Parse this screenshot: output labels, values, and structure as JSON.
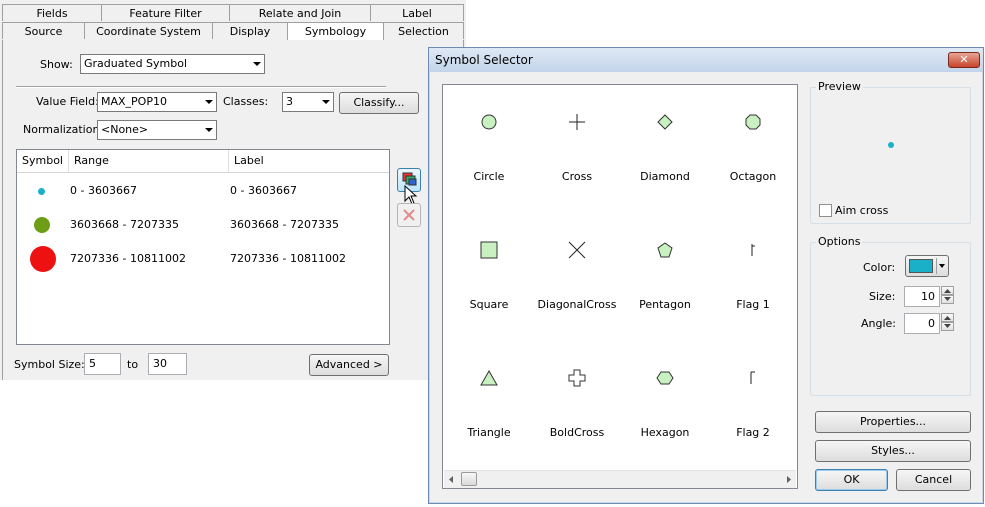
{
  "props": {
    "tabs_row1": [
      "Fields",
      "Feature Filter",
      "Relate and Join",
      "Label"
    ],
    "tabs_row2": [
      "Source",
      "Coordinate System",
      "Display",
      "Symbology",
      "Selection"
    ],
    "active_tab": "Symbology",
    "show_label": "Show:",
    "show_value": "Graduated Symbol",
    "value_field_label": "Value Field:",
    "value_field_value": "MAX_POP10",
    "classes_label": "Classes:",
    "classes_value": "3",
    "classify_button": "Classify...",
    "normalization_label": "Normalization:",
    "normalization_value": "<None>",
    "table": {
      "headers": [
        "Symbol",
        "Range",
        "Label"
      ],
      "rows": [
        {
          "range": "0 - 3603667",
          "label": "0 - 3603667",
          "color": "#1ab0c8",
          "size": "small"
        },
        {
          "range": "3603668 - 7207335",
          "label": "3603668 - 7207335",
          "color": "#6e9e16",
          "size": "medium"
        },
        {
          "range": "7207336 - 10811002",
          "label": "7207336 - 10811002",
          "color": "#ee1111",
          "size": "large"
        }
      ]
    },
    "symbol_size_label": "Symbol Size:",
    "symbol_size_min": "5",
    "to_label": "to",
    "symbol_size_max": "30",
    "advanced_button": "Advanced >"
  },
  "selector": {
    "title": "Symbol Selector",
    "close_glyph": "✕",
    "symbols": [
      {
        "name": "Circle",
        "icon": "circle-icon"
      },
      {
        "name": "Cross",
        "icon": "cross-icon"
      },
      {
        "name": "Diamond",
        "icon": "diamond-icon"
      },
      {
        "name": "Octagon",
        "icon": "octagon-icon"
      },
      {
        "name": "Square",
        "icon": "square-icon"
      },
      {
        "name": "DiagonalCross",
        "icon": "diagonal-cross-icon"
      },
      {
        "name": "Pentagon",
        "icon": "pentagon-icon"
      },
      {
        "name": "Flag 1",
        "icon": "flag-icon"
      },
      {
        "name": "Triangle",
        "icon": "triangle-icon"
      },
      {
        "name": "BoldCross",
        "icon": "bold-cross-icon"
      },
      {
        "name": "Hexagon",
        "icon": "hexagon-icon"
      },
      {
        "name": "Flag 2",
        "icon": "flag-icon"
      }
    ],
    "preview_label": "Preview",
    "aim_cross_label": "Aim cross",
    "options_label": "Options",
    "color_label": "Color:",
    "color_value": "#1ab0c8",
    "size_label": "Size:",
    "size_value": "10",
    "angle_label": "Angle:",
    "angle_value": "0",
    "properties_button": "Properties...",
    "styles_button": "Styles...",
    "ok_button": "OK",
    "cancel_button": "Cancel"
  }
}
